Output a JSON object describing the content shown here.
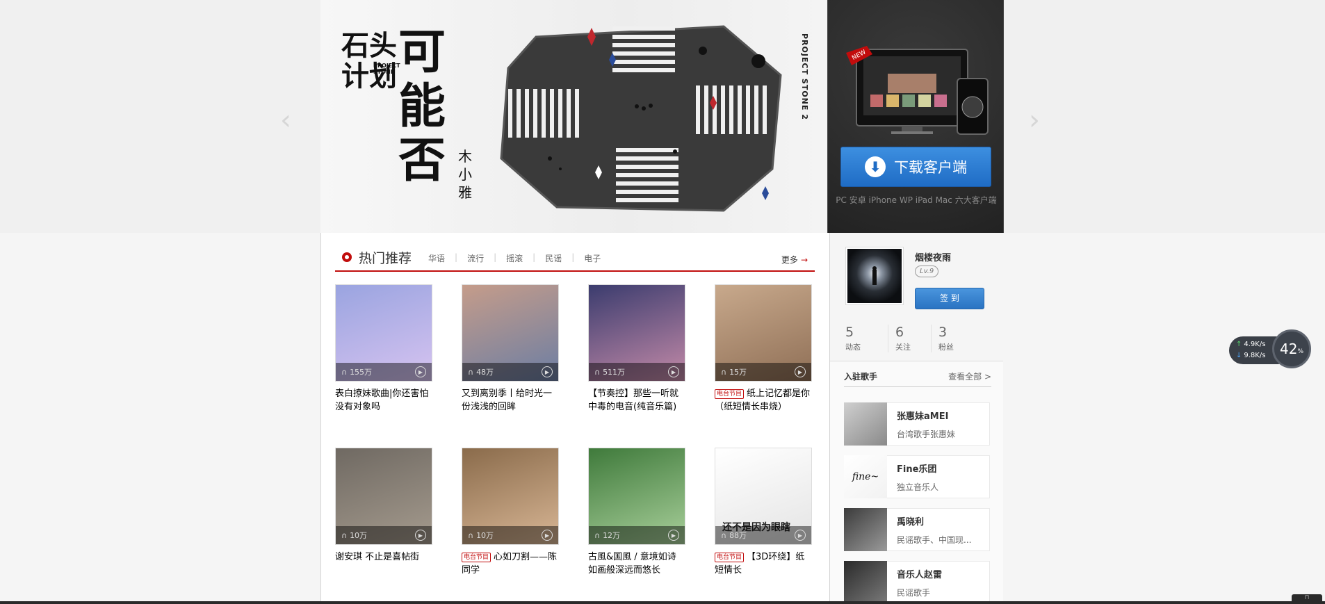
{
  "banner": {
    "logo_cn": "石头计划",
    "logo_en": "PROJECT STONE",
    "title": "可能否",
    "artist": "木小雅",
    "side_caption": "PROJECT STONE 2",
    "prev_arrow": "‹",
    "next_arrow": "›",
    "dot_count": 1
  },
  "download": {
    "new_badge": "NEW",
    "button_label": "下载客户端",
    "platforms": "PC 安卓 iPhone WP iPad Mac 六大客户端"
  },
  "hot": {
    "title": "热门推荐",
    "tags": [
      "华语",
      "流行",
      "摇滚",
      "民谣",
      "电子"
    ],
    "more": "更多",
    "more_arrow": "→"
  },
  "playlists": [
    {
      "plays": "155万",
      "title": "表白撩妹歌曲|你还害怕没有对象吗",
      "radio": false,
      "colors": [
        "#9aa4e0",
        "#d6c3f0"
      ]
    },
    {
      "plays": "48万",
      "title": "又到离别季丨给时光一份浅浅的回眸",
      "radio": false,
      "colors": [
        "#c59c8a",
        "#6c7ea3"
      ]
    },
    {
      "plays": "511万",
      "title": "【节奏控】那些一听就中毒的电音(纯音乐篇)",
      "radio": false,
      "colors": [
        "#3b3c6e",
        "#c38aa8"
      ]
    },
    {
      "plays": "15万",
      "title": "纸上记忆都是你（纸短情长串烧）",
      "radio": true,
      "colors": [
        "#c8a98c",
        "#8f6f56"
      ]
    },
    {
      "plays": "10万",
      "title": "谢安琪 不止是喜帖街",
      "radio": false,
      "colors": [
        "#6f6962",
        "#a59b8e"
      ]
    },
    {
      "plays": "10万",
      "title": "心如刀割——陈同学",
      "radio": true,
      "colors": [
        "#8a6b4b",
        "#d8b695"
      ]
    },
    {
      "plays": "12万",
      "title": "古風&国風 / 意境如诗 如画般深远而悠长",
      "radio": false,
      "colors": [
        "#3f7a3b",
        "#a8cf9a"
      ]
    },
    {
      "plays": "88万",
      "title": "【3D环绕】纸短情长",
      "radio": true,
      "colors": [
        "#ffffff",
        "#e4e4e4"
      ],
      "overlay": "还不是因为眼瞎"
    }
  ],
  "radio_badge": "电台节目",
  "user": {
    "name": "烟楼夜雨",
    "level": "Lv.9",
    "signin": "签 到",
    "stats": [
      {
        "num": "5",
        "label": "动态"
      },
      {
        "num": "6",
        "label": "关注"
      },
      {
        "num": "3",
        "label": "粉丝"
      }
    ]
  },
  "singers": {
    "title": "入驻歌手",
    "view_all": "查看全部 >",
    "items": [
      {
        "name": "张惠妹aMEI",
        "desc": "台湾歌手张惠妹",
        "colors": [
          "#cfcfcf",
          "#8a8a8a"
        ]
      },
      {
        "name": "Fine乐团",
        "desc": "独立音乐人",
        "colors": [
          "#ffffff",
          "#f2f2f2"
        ],
        "logo": "fine~"
      },
      {
        "name": "禹晓利",
        "desc": "民谣歌手、中国现...",
        "colors": [
          "#3b3b3b",
          "#9a9a9a"
        ]
      },
      {
        "name": "音乐人赵雷",
        "desc": "民谣歌手",
        "colors": [
          "#2a2a2a",
          "#7a7a7a"
        ]
      }
    ]
  },
  "speed": {
    "up": "4.9K/s",
    "down": "9.8K/s",
    "up_arrow": "↑",
    "down_arrow": "↓",
    "percent": "42",
    "percent_sign": "%"
  },
  "colors": {
    "accent": "#c10d0c",
    "button_blue": "#2a73c2"
  }
}
